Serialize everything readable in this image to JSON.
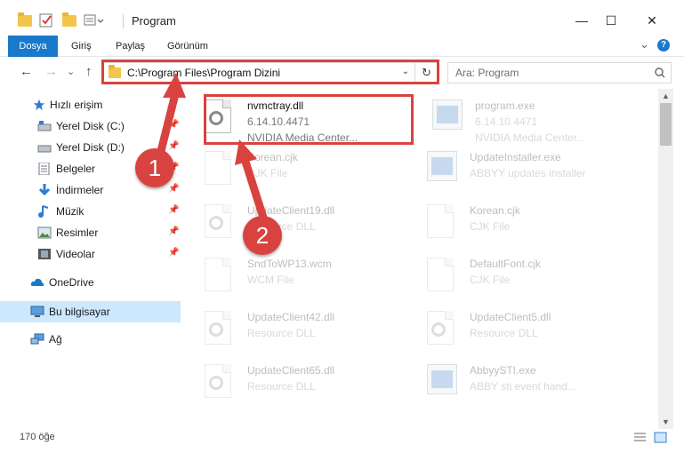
{
  "window": {
    "title": "Program",
    "minimize_glyph": "—",
    "maximize_glyph": "☐",
    "close_glyph": "✕"
  },
  "ribbon": {
    "tabs": [
      "Dosya",
      "Giriş",
      "Paylaş",
      "Görünüm"
    ],
    "expand_glyph": "⌄",
    "help_glyph": "?"
  },
  "nav": {
    "back": "←",
    "forward": "→",
    "recent": "⌄",
    "up": "↑"
  },
  "address": {
    "path": "C:\\Program Files\\Program Dizini",
    "refresh_glyph": "↻",
    "dropdown_glyph": "⌄"
  },
  "search": {
    "placeholder": "Ara: Program"
  },
  "sidebar": {
    "items": [
      {
        "label": "Hızlı erişim",
        "icon": "star-icon"
      },
      {
        "label": "Yerel Disk (C:)",
        "icon": "drive-icon"
      },
      {
        "label": "Yerel Disk (D:)",
        "icon": "drive-icon"
      },
      {
        "label": "Belgeler",
        "icon": "documents-icon"
      },
      {
        "label": "İndirmeler",
        "icon": "download-icon"
      },
      {
        "label": "Müzik",
        "icon": "music-icon"
      },
      {
        "label": "Resimler",
        "icon": "pictures-icon"
      },
      {
        "label": "Videolar",
        "icon": "video-icon"
      },
      {
        "label": "OneDrive",
        "icon": "cloud-icon"
      },
      {
        "label": "Bu bilgisayar",
        "icon": "computer-icon"
      },
      {
        "label": "Ağ",
        "icon": "network-icon"
      }
    ],
    "pin_glyph": "📌"
  },
  "files": [
    {
      "name": "nvmctray.dll",
      "line1": "6.14.10.4471",
      "line2": "NVIDIA Media Center...",
      "icon": "dll-file-icon"
    },
    {
      "name": "program.exe",
      "line1": "6.14.10.4471",
      "line2": "NVIDIA Media Center...",
      "icon": "exe-file-icon"
    },
    {
      "name": "Korean.cjk",
      "line1": "CJK File",
      "line2": "",
      "icon": "document-file-icon"
    },
    {
      "name": "UpdateInstaller.exe",
      "line1": "ABBYY updates installer",
      "line2": "",
      "icon": "app-window-icon"
    },
    {
      "name": "UpdateClient19.dll",
      "line1": "Resource DLL",
      "line2": "",
      "icon": "dll-file-icon"
    },
    {
      "name": "Korean.cjk",
      "line1": "CJK File",
      "line2": "",
      "icon": "document-file-icon"
    },
    {
      "name": "SndToWP13.wcm",
      "line1": "WCM File",
      "line2": "",
      "icon": "document-file-icon"
    },
    {
      "name": "DefaultFont.cjk",
      "line1": "CJK File",
      "line2": "",
      "icon": "document-file-icon"
    },
    {
      "name": "UpdateClient42.dll",
      "line1": "Resource DLL",
      "line2": "",
      "icon": "dll-file-icon"
    },
    {
      "name": "UpdateClient5.dll",
      "line1": "Resource DLL",
      "line2": "",
      "icon": "dll-file-icon"
    },
    {
      "name": "UpdateClient65.dll",
      "line1": "Resource DLL",
      "line2": "",
      "icon": "dll-file-icon"
    },
    {
      "name": "AbbyySTI.exe",
      "line1": "ABBY sti event hand...",
      "line2": "",
      "icon": "app-window-icon"
    }
  ],
  "status": {
    "count": "170 öğe"
  },
  "annotations": {
    "badge1": "1",
    "badge2": "2",
    "color": "#d9433f"
  }
}
